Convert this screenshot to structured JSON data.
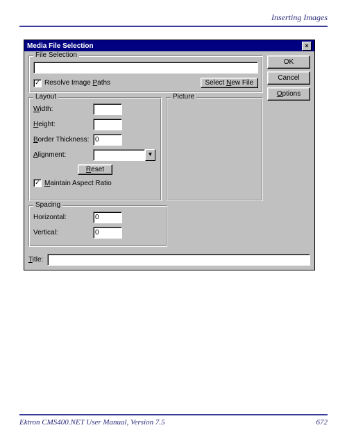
{
  "header": {
    "section": "Inserting Images"
  },
  "footer": {
    "manual": "Ektron CMS400.NET User Manual, Version 7.5",
    "page": "672"
  },
  "dialog": {
    "title": "Media File Selection",
    "close": "×",
    "buttons": {
      "ok": "OK",
      "cancel": "Cancel",
      "options": "Options"
    },
    "fileSelection": {
      "legend": "File Selection",
      "path": "",
      "resolvePaths": "Resolve Image Paths",
      "resolveChecked": "✓",
      "selectNew": "Select New File"
    },
    "layout": {
      "legend": "Layout",
      "width": "Width:",
      "height": "Height:",
      "border": "Border Thickness:",
      "borderVal": "0",
      "alignment": "Alignment:",
      "reset": "Reset",
      "maintain": "Maintain Aspect Ratio",
      "maintainChecked": "✓"
    },
    "picture": {
      "legend": "Picture"
    },
    "spacing": {
      "legend": "Spacing",
      "horizontal": "Horizontal:",
      "hVal": "0",
      "vertical": "Vertical:",
      "vVal": "0"
    },
    "titleRow": {
      "label": "Title:",
      "value": ""
    }
  },
  "accesskeys": {
    "resolve": "P",
    "selectNew": "N",
    "options": "O",
    "width": "W",
    "height": "H",
    "border": "B",
    "alignment": "A",
    "reset": "R",
    "maintain": "M",
    "title": "T"
  }
}
